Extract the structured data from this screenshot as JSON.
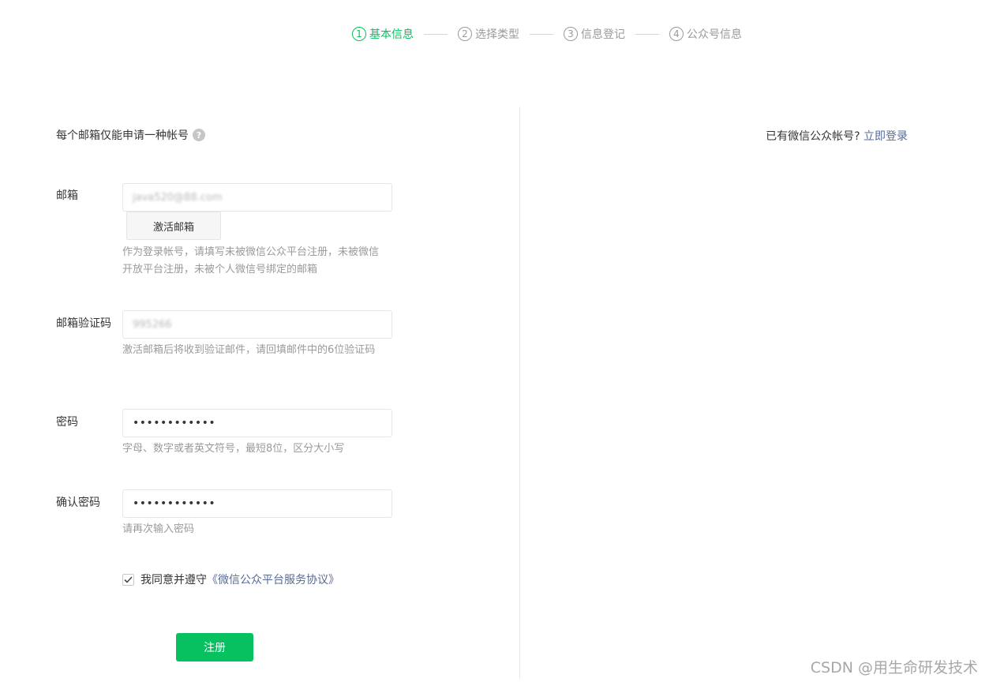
{
  "stepper": {
    "steps": [
      {
        "num": "1",
        "label": "基本信息",
        "active": true
      },
      {
        "num": "2",
        "label": "选择类型",
        "active": false
      },
      {
        "num": "3",
        "label": "信息登记",
        "active": false
      },
      {
        "num": "4",
        "label": "公众号信息",
        "active": false
      }
    ]
  },
  "notice": {
    "text": "每个邮箱仅能申请一种帐号",
    "help_icon": "?"
  },
  "login_prompt": {
    "text": "已有微信公众帐号?",
    "link": "立即登录"
  },
  "form": {
    "email": {
      "label": "邮箱",
      "value": "java520@88.com",
      "activate_button": "激活邮箱",
      "hint": "作为登录帐号，请填写未被微信公众平台注册，未被微信开放平台注册，未被个人微信号绑定的邮箱"
    },
    "code": {
      "label": "邮箱验证码",
      "value": "995266",
      "hint": "激活邮箱后将收到验证邮件，请回填邮件中的6位验证码"
    },
    "password": {
      "label": "密码",
      "value": "••••••••••••",
      "hint": "字母、数字或者英文符号，最短8位，区分大小写"
    },
    "confirm_password": {
      "label": "确认密码",
      "value": "••••••••••••",
      "hint": "请再次输入密码"
    },
    "agreement": {
      "checked": true,
      "text": "我同意并遵守",
      "link": "《微信公众平台服务协议》"
    },
    "register_button": "注册"
  },
  "watermark": "CSDN @用生命研发技术",
  "colors": {
    "accent": "#07c160",
    "link": "#576b95",
    "hint": "#9a9a9a"
  }
}
